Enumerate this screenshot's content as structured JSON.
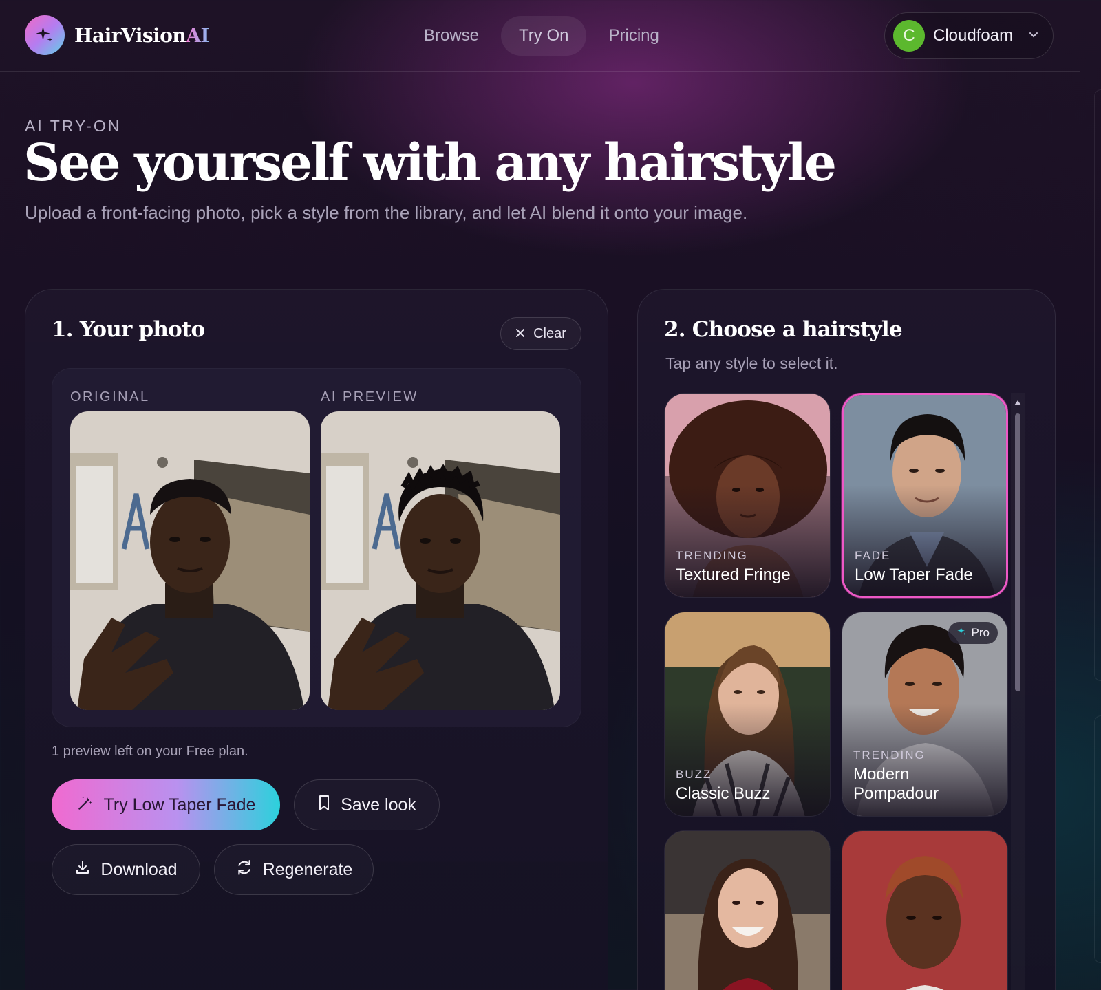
{
  "brand": {
    "name_part1": "HairVision",
    "name_part2": "AI",
    "icon": "sparkle-icon",
    "gradient": [
      "#f06ac4",
      "#5fd2e8"
    ]
  },
  "nav": {
    "links": [
      {
        "label": "Browse",
        "active": false
      },
      {
        "label": "Try On",
        "active": true
      },
      {
        "label": "Pricing",
        "active": false
      }
    ]
  },
  "user": {
    "initial": "C",
    "name": "Cloudfoam",
    "avatar_color": "#5cb82e",
    "menu_icon": "chevron-down-icon"
  },
  "hero": {
    "eyebrow": "AI TRY-ON",
    "title": "See yourself with any hairstyle",
    "subtitle": "Upload a front-facing photo, pick a style from the library, and let AI blend it onto your image."
  },
  "photo_panel": {
    "title": "1. Your photo",
    "clear_label": "Clear",
    "original_label": "ORIGINAL",
    "preview_label": "AI PREVIEW",
    "plan_note": "1 preview left on your Free plan.",
    "try_label": "Try Low Taper Fade",
    "save_label": "Save look",
    "download_label": "Download",
    "regenerate_label": "Regenerate"
  },
  "style_panel": {
    "title": "2. Choose a hairstyle",
    "subtitle": "Tap any style to select it.",
    "styles": [
      {
        "tag": "TRENDING",
        "name": "Textured Fringe",
        "selected": false,
        "pro": false
      },
      {
        "tag": "FADE",
        "name": "Low Taper Fade",
        "selected": true,
        "pro": false
      },
      {
        "tag": "BUZZ",
        "name": "Classic Buzz",
        "selected": false,
        "pro": false
      },
      {
        "tag": "TRENDING",
        "name": "Modern Pompadour",
        "selected": false,
        "pro": true,
        "pro_label": "Pro"
      },
      {
        "tag": "",
        "name": "",
        "selected": false,
        "pro": false
      },
      {
        "tag": "",
        "name": "",
        "selected": false,
        "pro": false
      }
    ]
  },
  "colors": {
    "accent_pink": "#ee58c6",
    "accent_cyan": "#2cd1dc"
  }
}
